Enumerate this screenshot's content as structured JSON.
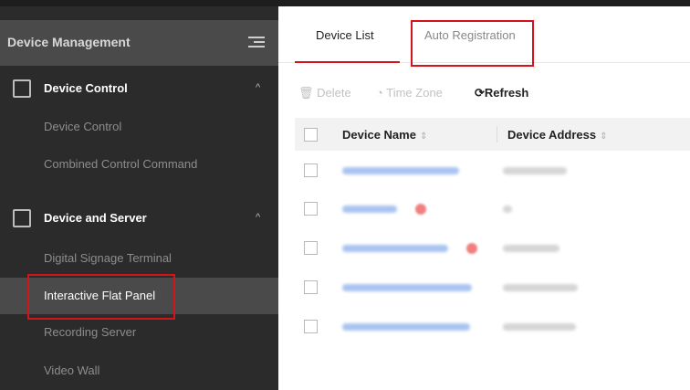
{
  "sidebar": {
    "title": "Device Management",
    "groups": [
      {
        "label": "Device Control",
        "items": [
          {
            "label": "Device Control"
          },
          {
            "label": "Combined Control Command"
          }
        ]
      },
      {
        "label": "Device and Server",
        "items": [
          {
            "label": "Digital Signage Terminal"
          },
          {
            "label": "Interactive Flat Panel",
            "active": true
          },
          {
            "label": "Recording Server"
          },
          {
            "label": "Video Wall"
          }
        ]
      }
    ]
  },
  "main": {
    "tabs": [
      {
        "label": "Device List",
        "active": true
      },
      {
        "label": "Auto Registration",
        "highlighted": true
      }
    ],
    "toolbar": {
      "delete_label": "Delete",
      "timezone_label": "Time Zone",
      "refresh_label": "Refresh"
    },
    "table": {
      "columns": [
        "Device Name",
        "Device Address"
      ],
      "rows_blurred": 5
    }
  },
  "colors": {
    "accent": "#d6131b",
    "sidebar_bg": "#2b2b2b",
    "sidebar_header_bg": "#4a4a4a"
  }
}
